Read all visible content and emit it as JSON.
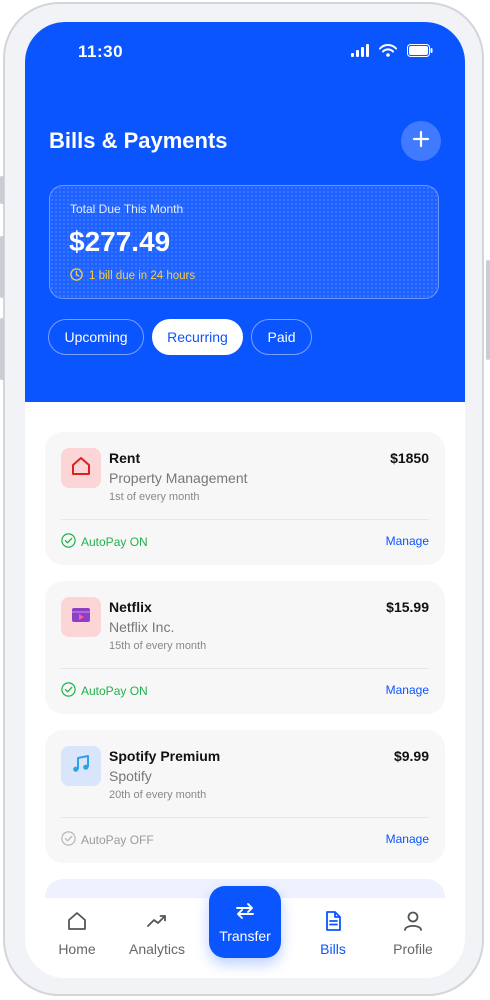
{
  "status_bar": {
    "time": "11:30"
  },
  "header": {
    "title": "Bills & Payments"
  },
  "summary": {
    "label": "Total Due This Month",
    "amount": "$277.49",
    "due_note": "1 bill due in 24 hours"
  },
  "tabs": [
    {
      "label": "Upcoming",
      "active": false
    },
    {
      "label": "Recurring",
      "active": true
    },
    {
      "label": "Paid",
      "active": false
    }
  ],
  "bills": [
    {
      "name": "Rent",
      "company": "Property Management",
      "frequency": "1st of every month",
      "amount": "$1850",
      "autopay": "AutoPay ON",
      "autopay_on": true,
      "action": "Manage",
      "icon": "home-icon"
    },
    {
      "name": "Netflix",
      "company": "Netflix Inc.",
      "frequency": "15th of every month",
      "amount": "$15.99",
      "autopay": "AutoPay ON",
      "autopay_on": true,
      "action": "Manage",
      "icon": "video-icon"
    },
    {
      "name": "Spotify Premium",
      "company": "Spotify",
      "frequency": "20th of every month",
      "amount": "$9.99",
      "autopay": "AutoPay OFF",
      "autopay_on": false,
      "action": "Manage",
      "icon": "music-icon"
    }
  ],
  "nav": {
    "home": "Home",
    "analytics": "Analytics",
    "transfer": "Transfer",
    "bills": "Bills",
    "profile": "Profile",
    "active": "bills"
  },
  "colors": {
    "primary": "#0b55ff",
    "autopay_on": "#22b14c",
    "autopay_off": "#9a9a9a",
    "due_warning": "#ffcf3d"
  }
}
